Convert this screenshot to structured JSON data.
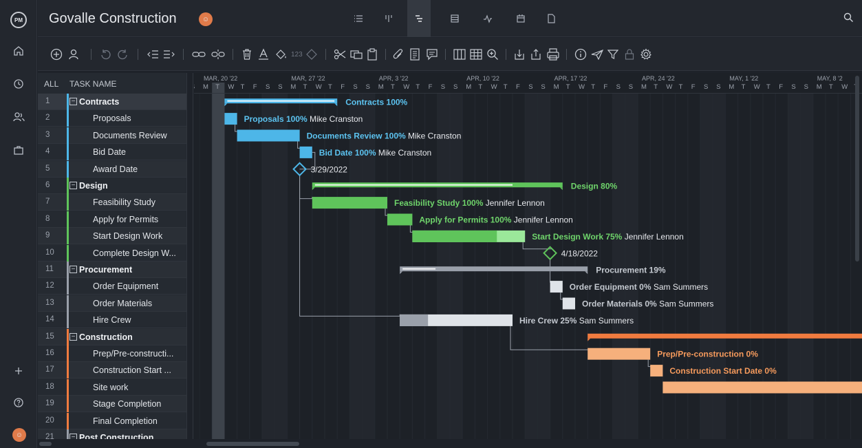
{
  "app": {
    "logo": "PM",
    "project_title": "Govalle Construction"
  },
  "rail": {
    "icons": [
      "home-icon",
      "clock-icon",
      "people-icon",
      "briefcase-icon",
      "plus-icon",
      "help-icon"
    ]
  },
  "header": {
    "views": [
      "list-view-icon",
      "board-view-icon",
      "gantt-view-icon",
      "sheet-view-icon",
      "dashboard-view-icon",
      "calendar-view-icon",
      "files-view-icon"
    ],
    "active_view": "gantt-view-icon"
  },
  "toolbar": {
    "icons": [
      "add-task-icon",
      "add-user-icon",
      "undo-icon",
      "redo-icon",
      "outdent-icon",
      "indent-icon",
      "link-icon",
      "unlink-icon",
      "delete-icon",
      "font-color-icon",
      "fill-color-icon",
      "numbering-icon",
      "milestone-icon",
      "cut-icon",
      "copy-icon",
      "paste-icon",
      "attach-icon",
      "notes-icon",
      "comment-icon",
      "columns-icon",
      "grid-icon",
      "zoom-icon",
      "import-icon",
      "export-icon",
      "print-icon",
      "info-icon",
      "send-icon",
      "filter-icon",
      "lock-icon",
      "settings-icon"
    ],
    "numbering_label": "123"
  },
  "grid": {
    "col_all": "ALL",
    "col_task": "TASK NAME",
    "rows": [
      {
        "num": "1",
        "name": "Contracts",
        "group": true,
        "color": "#4db6e8"
      },
      {
        "num": "2",
        "name": "Proposals",
        "group": false,
        "color": "#4db6e8"
      },
      {
        "num": "3",
        "name": "Documents Review",
        "group": false,
        "color": "#4db6e8"
      },
      {
        "num": "4",
        "name": "Bid Date",
        "group": false,
        "color": "#4db6e8"
      },
      {
        "num": "5",
        "name": "Award Date",
        "group": false,
        "color": "#4db6e8"
      },
      {
        "num": "6",
        "name": "Design",
        "group": true,
        "color": "#5fc45b"
      },
      {
        "num": "7",
        "name": "Feasibility Study",
        "group": false,
        "color": "#5fc45b"
      },
      {
        "num": "8",
        "name": "Apply for Permits",
        "group": false,
        "color": "#5fc45b"
      },
      {
        "num": "9",
        "name": "Start Design Work",
        "group": false,
        "color": "#5fc45b"
      },
      {
        "num": "10",
        "name": "Complete Design W...",
        "group": false,
        "color": "#5fc45b"
      },
      {
        "num": "11",
        "name": "Procurement",
        "group": true,
        "color": "#9aa0aa"
      },
      {
        "num": "12",
        "name": "Order Equipment",
        "group": false,
        "color": "#9aa0aa"
      },
      {
        "num": "13",
        "name": "Order Materials",
        "group": false,
        "color": "#9aa0aa"
      },
      {
        "num": "14",
        "name": "Hire Crew",
        "group": false,
        "color": "#9aa0aa"
      },
      {
        "num": "15",
        "name": "Construction",
        "group": true,
        "color": "#f07b3f"
      },
      {
        "num": "16",
        "name": "Prep/Pre-constructi...",
        "group": false,
        "color": "#f07b3f"
      },
      {
        "num": "17",
        "name": "Construction Start ...",
        "group": false,
        "color": "#f07b3f"
      },
      {
        "num": "18",
        "name": "Site work",
        "group": false,
        "color": "#f07b3f"
      },
      {
        "num": "19",
        "name": "Stage Completion",
        "group": false,
        "color": "#f07b3f"
      },
      {
        "num": "20",
        "name": "Final Completion",
        "group": false,
        "color": "#f07b3f"
      },
      {
        "num": "21",
        "name": "Post Construction",
        "group": true,
        "color": "#9aa0aa"
      }
    ]
  },
  "timeline": {
    "start_date": "2022-03-21",
    "weeks": [
      "MAR, 20 '22",
      "MAR, 27 '22",
      "APR, 3 '22",
      "APR, 10 '22",
      "APR, 17 '22",
      "APR, 24 '22",
      "MAY, 1 '22",
      "MAY, 8 '2"
    ],
    "day_letters": [
      "M",
      "T",
      "W",
      "T",
      "F",
      "S",
      "S"
    ],
    "today": "2022-03-22"
  },
  "colors": {
    "contracts": "#4db6e8",
    "contracts_text": "#5cc3f0",
    "design": "#5fc45b",
    "design_light": "#9be89a",
    "design_text": "#6fd46b",
    "procurement": "#9aa0aa",
    "procurement_light": "#dfe3e8",
    "procurement_text": "#c4c9d0",
    "construction": "#f07b3f",
    "construction_light": "#f6b07c",
    "construction_text": "#f59a5c",
    "white_text": "#e6e8ec"
  },
  "tasks": [
    {
      "row": 0,
      "type": "summary",
      "start": "2022-03-23",
      "end": "2022-04-01",
      "progress": 1.0,
      "color": "contracts",
      "label": "Contracts",
      "pct": "100%",
      "assignee": ""
    },
    {
      "row": 1,
      "type": "task",
      "start": "2022-03-23",
      "end": "2022-03-24",
      "progress": 1.0,
      "color": "contracts",
      "label": "Proposals",
      "pct": "100%",
      "assignee": "Mike Cranston"
    },
    {
      "row": 2,
      "type": "task",
      "start": "2022-03-24",
      "end": "2022-03-29",
      "progress": 1.0,
      "color": "contracts",
      "label": "Documents Review",
      "pct": "100%",
      "assignee": "Mike Cranston"
    },
    {
      "row": 3,
      "type": "task",
      "start": "2022-03-29",
      "end": "2022-03-30",
      "progress": 1.0,
      "color": "contracts",
      "label": "Bid Date",
      "pct": "100%",
      "assignee": "Mike Cranston"
    },
    {
      "row": 4,
      "type": "milestone",
      "start": "2022-03-29",
      "color": "contracts",
      "label": "3/29/2022"
    },
    {
      "row": 5,
      "type": "summary",
      "start": "2022-03-30",
      "end": "2022-04-19",
      "progress": 0.8,
      "color": "design",
      "label": "Design",
      "pct": "80%",
      "assignee": ""
    },
    {
      "row": 6,
      "type": "task",
      "start": "2022-03-30",
      "end": "2022-04-05",
      "progress": 1.0,
      "color": "design",
      "label": "Feasibility Study",
      "pct": "100%",
      "assignee": "Jennifer Lennon"
    },
    {
      "row": 7,
      "type": "task",
      "start": "2022-04-05",
      "end": "2022-04-07",
      "progress": 1.0,
      "color": "design",
      "label": "Apply for Permits",
      "pct": "100%",
      "assignee": "Jennifer Lennon"
    },
    {
      "row": 8,
      "type": "task",
      "start": "2022-04-07",
      "end": "2022-04-16",
      "progress": 0.75,
      "color": "design",
      "label": "Start Design Work",
      "pct": "75%",
      "assignee": "Jennifer Lennon"
    },
    {
      "row": 9,
      "type": "milestone",
      "start": "2022-04-18",
      "color": "design",
      "label": "4/18/2022"
    },
    {
      "row": 10,
      "type": "summary",
      "start": "2022-04-06",
      "end": "2022-04-21",
      "progress": 0.19,
      "color": "procurement",
      "label": "Procurement",
      "pct": "19%",
      "assignee": ""
    },
    {
      "row": 11,
      "type": "task",
      "start": "2022-04-18",
      "end": "2022-04-19",
      "progress": 0.0,
      "color": "procurement",
      "label": "Order Equipment",
      "pct": "0%",
      "assignee": "Sam Summers"
    },
    {
      "row": 12,
      "type": "task",
      "start": "2022-04-19",
      "end": "2022-04-20",
      "progress": 0.0,
      "color": "procurement",
      "label": "Order Materials",
      "pct": "0%",
      "assignee": "Sam Summers"
    },
    {
      "row": 13,
      "type": "task",
      "start": "2022-04-06",
      "end": "2022-04-15",
      "progress": 0.25,
      "color": "procurement",
      "label": "Hire Crew",
      "pct": "25%",
      "assignee": "Sam Summers"
    },
    {
      "row": 14,
      "type": "summary",
      "start": "2022-04-21",
      "end": "2022-05-15",
      "progress": 0.0,
      "color": "construction",
      "label": "",
      "pct": "",
      "assignee": ""
    },
    {
      "row": 15,
      "type": "task",
      "start": "2022-04-21",
      "end": "2022-04-26",
      "progress": 0.0,
      "color": "construction",
      "label": "Prep/Pre-construction",
      "pct": "0%",
      "assignee": ""
    },
    {
      "row": 16,
      "type": "task",
      "start": "2022-04-26",
      "end": "2022-04-27",
      "progress": 0.0,
      "color": "construction",
      "label": "Construction Start Date",
      "pct": "0%",
      "assignee": ""
    },
    {
      "row": 17,
      "type": "task",
      "start": "2022-04-27",
      "end": "2022-05-15",
      "progress": 0.0,
      "color": "construction",
      "label": "",
      "pct": "",
      "assignee": ""
    }
  ],
  "dependencies": [
    {
      "from": 1,
      "to": 2
    },
    {
      "from": 2,
      "to": 3
    },
    {
      "from": 3,
      "to": 4
    },
    {
      "from": 4,
      "to": 6
    },
    {
      "from": 6,
      "to": 7
    },
    {
      "from": 7,
      "to": 8
    },
    {
      "from": 8,
      "to": 9
    },
    {
      "from": 9,
      "to": 11
    },
    {
      "from": 11,
      "to": 12
    },
    {
      "from": 4,
      "to": 13
    },
    {
      "from": 13,
      "to": 15
    },
    {
      "from": 15,
      "to": 16
    }
  ]
}
